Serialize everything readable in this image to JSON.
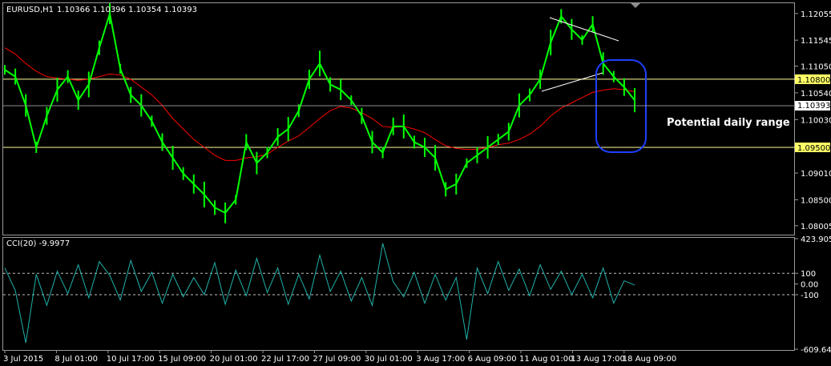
{
  "main": {
    "symbol": "EURUSD,H1",
    "ohlc": "1.10366 1.10396 1.10354 1.10393",
    "annotation": "Potential daily range",
    "current_price_label": "1.10393",
    "levels": [
      {
        "label": "1.10800",
        "value": 1.108,
        "color": "#ffff66"
      },
      {
        "label": "1.09500",
        "value": 1.095,
        "color": "#ffff66"
      }
    ]
  },
  "indicator": {
    "title": "CCI(20) -9.9977",
    "levels": [
      100,
      -100
    ]
  },
  "colors": {
    "price": "#00ff00",
    "moving_average": "#ff0000",
    "cci": "#20b2aa",
    "level_line": "#ffff99",
    "range_box": "#1f3fff",
    "trendlines": "#ffffff"
  },
  "chart_data": [
    {
      "type": "line",
      "title": "EURUSD,H1",
      "y_ticks": [
        "1.12055",
        "1.11545",
        "1.11050",
        "1.10540",
        "1.10030",
        "1.09010",
        "1.08500",
        "1.08005"
      ],
      "ylim": [
        1.0788,
        1.1222
      ],
      "x_ticks": [
        "3 Jul 2015",
        "8 Jul 01:00",
        "10 Jul 17:00",
        "15 Jul 09:00",
        "20 Jul 01:00",
        "22 Jul 17:00",
        "27 Jul 09:00",
        "30 Jul 01:00",
        "3 Aug 17:00",
        "6 Aug 09:00",
        "11 Aug 01:00",
        "13 Aug 17:00",
        "18 Aug 09:00"
      ],
      "series": [
        {
          "name": "EURUSD,H1",
          "values": [
            1.1098,
            1.1085,
            1.103,
            1.095,
            1.101,
            1.106,
            1.1085,
            1.104,
            1.107,
            1.114,
            1.1205,
            1.11,
            1.105,
            1.103,
            1.1,
            1.096,
            1.093,
            1.09,
            1.088,
            1.086,
            1.0835,
            1.0825,
            1.085,
            1.096,
            1.092,
            1.094,
            1.097,
            1.0985,
            1.102,
            1.108,
            1.111,
            1.107,
            1.106,
            1.104,
            1.101,
            1.096,
            1.094,
            1.099,
            1.099,
            1.096,
            1.095,
            1.093,
            1.087,
            1.088,
            1.092,
            1.0935,
            1.095,
            1.0965,
            1.098,
            1.103,
            1.105,
            1.108,
            1.115,
            1.12,
            1.1175,
            1.1155,
            1.1185,
            1.111,
            1.1085,
            1.1065,
            1.104
          ]
        },
        {
          "name": "Moving average",
          "values": [
            1.114,
            1.1128,
            1.111,
            1.1095,
            1.1085,
            1.1082,
            1.108,
            1.1078,
            1.108,
            1.1085,
            1.109,
            1.1088,
            1.108,
            1.1065,
            1.105,
            1.103,
            1.1005,
            1.0985,
            1.0965,
            1.095,
            1.0935,
            1.0925,
            1.0925,
            1.093,
            1.0932,
            1.0937,
            1.095,
            1.0962,
            1.0972,
            1.0988,
            1.1005,
            1.102,
            1.1028,
            1.1025,
            1.1016,
            1.1005,
            1.099,
            1.0988,
            1.099,
            1.0985,
            1.0978,
            1.0965,
            1.0953,
            1.0948,
            1.0946,
            1.0946,
            1.095,
            1.0955,
            1.0958,
            1.0965,
            1.0975,
            1.099,
            1.101,
            1.1025,
            1.1035,
            1.1045,
            1.1055,
            1.1059,
            1.1062,
            1.106,
            1.1056
          ]
        }
      ]
    },
    {
      "type": "line",
      "title": "CCI(20) -9.9977",
      "y_ticks": [
        "423.9051",
        "100",
        "0.00",
        "-100",
        "-609.6474"
      ],
      "ylim": [
        -609.6474,
        423.9051
      ],
      "x_ticks": [
        "3 Jul 2015",
        "8 Jul 01:00",
        "10 Jul 17:00",
        "15 Jul 09:00",
        "20 Jul 01:00",
        "22 Jul 17:00",
        "27 Jul 09:00",
        "30 Jul 01:00",
        "3 Aug 17:00",
        "6 Aug 09:00",
        "11 Aug 01:00",
        "13 Aug 17:00",
        "18 Aug 09:00"
      ],
      "series": [
        {
          "name": "CCI(20)",
          "values": [
            150,
            -60,
            -550,
            90,
            -200,
            120,
            -90,
            180,
            -130,
            210,
            80,
            -150,
            220,
            -70,
            110,
            -180,
            90,
            -120,
            60,
            -100,
            200,
            -190,
            130,
            -110,
            240,
            -80,
            150,
            -190,
            90,
            -140,
            270,
            -70,
            120,
            -160,
            60,
            -200,
            380,
            20,
            -120,
            110,
            -180,
            90,
            -150,
            60,
            -520,
            150,
            -90,
            210,
            -60,
            140,
            -110,
            180,
            -50,
            120,
            -100,
            90,
            -130,
            150,
            -180,
            30,
            -10
          ]
        }
      ]
    }
  ]
}
